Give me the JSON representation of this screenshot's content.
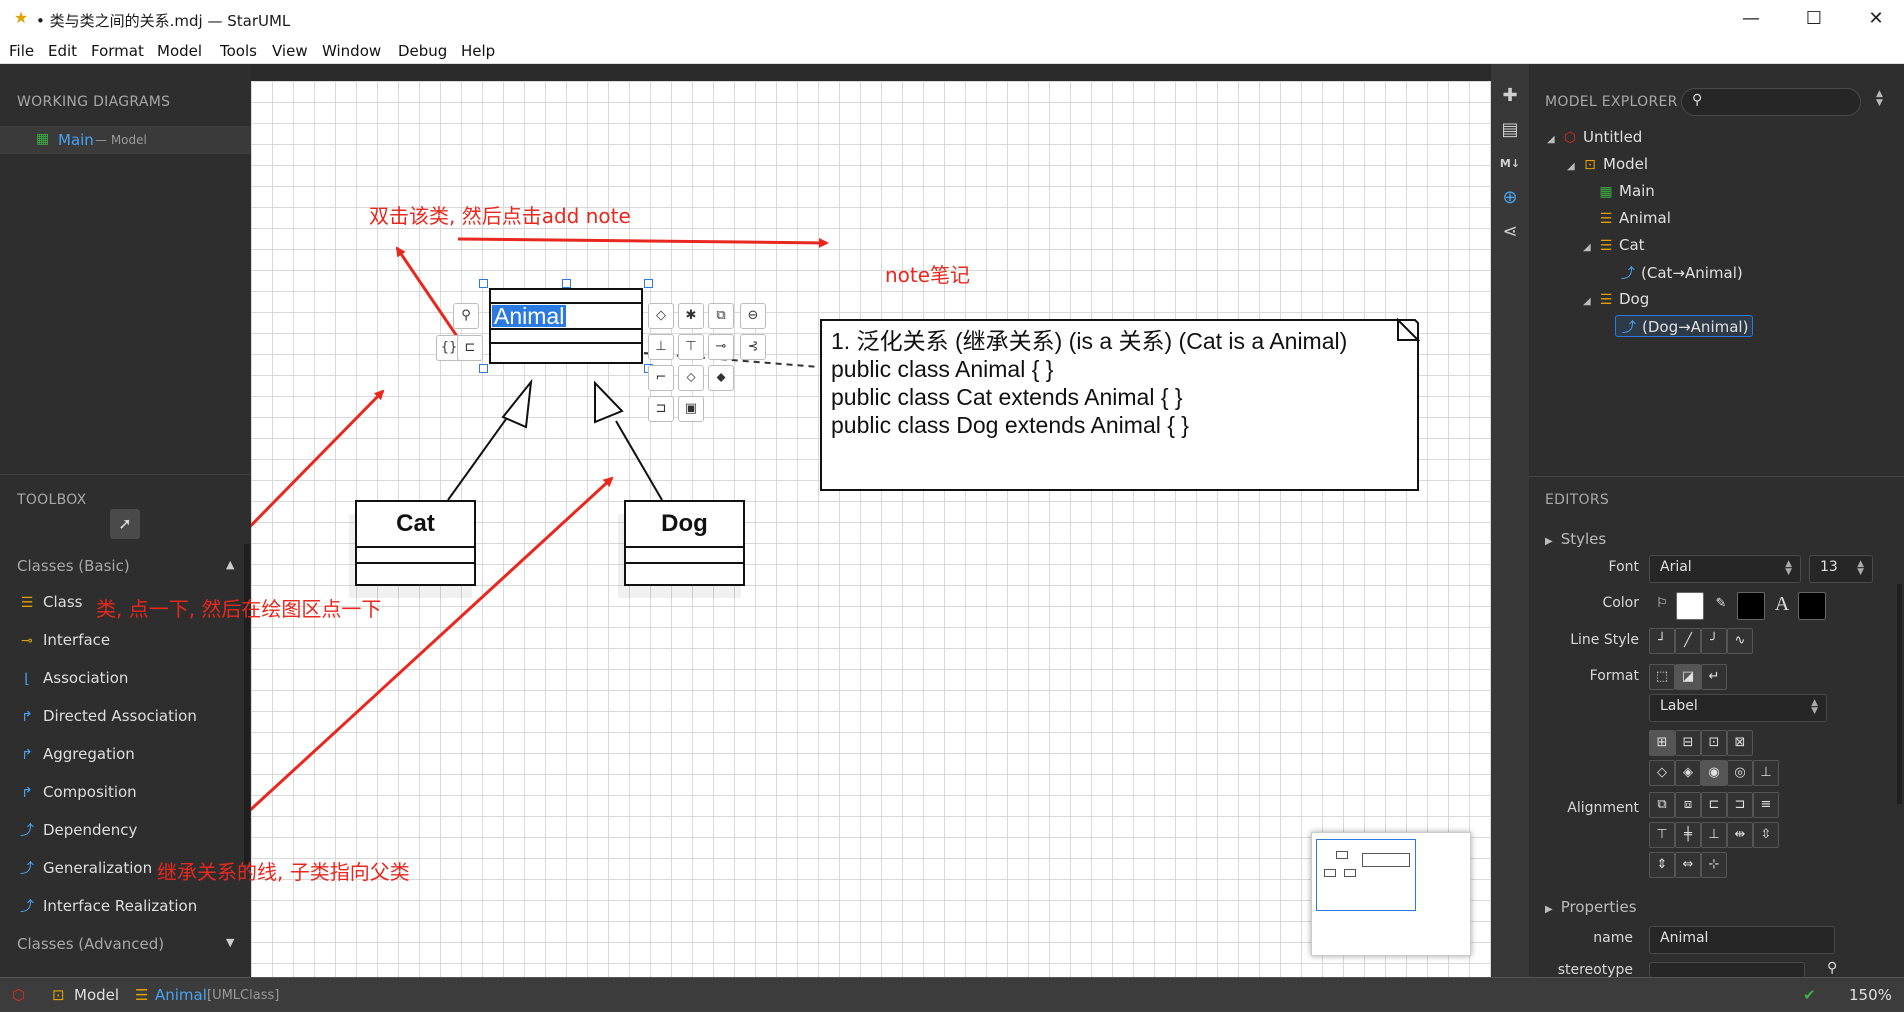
{
  "window": {
    "title": "• 类与类之间的关系.mdj — StarUML",
    "buttons": {
      "minimize": "—",
      "maximize": "☐",
      "close": "✕"
    }
  },
  "menu": [
    "File",
    "Edit",
    "Format",
    "Model",
    "Tools",
    "View",
    "Window",
    "Debug",
    "Help"
  ],
  "working_diagrams": {
    "header": "WORKING DIAGRAMS",
    "item_label": "Main",
    "item_sub": "— Model"
  },
  "toolbox": {
    "header": "TOOLBOX",
    "group_basic": "Classes (Basic)",
    "group_advanced": "Classes (Advanced)",
    "items": [
      {
        "label": "Class",
        "icon": "class-icon"
      },
      {
        "label": "Interface",
        "icon": "interface-icon"
      },
      {
        "label": "Association",
        "icon": "association-icon"
      },
      {
        "label": "Directed Association",
        "icon": "directed-association-icon"
      },
      {
        "label": "Aggregation",
        "icon": "aggregation-icon"
      },
      {
        "label": "Composition",
        "icon": "composition-icon"
      },
      {
        "label": "Dependency",
        "icon": "dependency-icon"
      },
      {
        "label": "Generalization",
        "icon": "generalization-icon"
      },
      {
        "label": "Interface Realization",
        "icon": "interface-realization-icon"
      }
    ]
  },
  "diagram": {
    "classes": {
      "animal": "Animal",
      "cat": "Cat",
      "dog": "Dog"
    },
    "note_lines": [
      "1. 泛化关系 (继承关系) (is a 关系) (Cat is a Animal)",
      "public class Animal { }",
      "public class Cat extends Animal { }",
      "public class Dog extends Animal { }"
    ],
    "annotations": {
      "double_click": "双击该类, 然后点击add note",
      "note": "note笔记",
      "class_tip": "类, 点一下, 然后在绘图区点一下",
      "generalization_tip": "继承关系的线, 子类指向父类"
    }
  },
  "model_explorer": {
    "header": "MODEL EXPLORER",
    "search_placeholder": "",
    "tree": [
      {
        "label": "Untitled",
        "depth": 0,
        "expanded": true,
        "icon": "project-icon"
      },
      {
        "label": "Model",
        "depth": 1,
        "expanded": true,
        "icon": "model-icon"
      },
      {
        "label": "Main",
        "depth": 2,
        "icon": "diagram-icon"
      },
      {
        "label": "Animal",
        "depth": 2,
        "icon": "class-icon"
      },
      {
        "label": "Cat",
        "depth": 2,
        "expanded": true,
        "icon": "class-icon"
      },
      {
        "label": "(Cat→Animal)",
        "depth": 3,
        "icon": "generalization-icon"
      },
      {
        "label": "Dog",
        "depth": 2,
        "expanded": true,
        "icon": "class-icon"
      },
      {
        "label": "(Dog→Animal)",
        "depth": 3,
        "icon": "generalization-icon",
        "selected": true
      }
    ]
  },
  "editors": {
    "header": "EDITORS",
    "styles_label": "Styles",
    "font_label": "Font",
    "font_value": "Arial",
    "font_size": "13",
    "color_label": "Color",
    "line_style_label": "Line Style",
    "format_label": "Format",
    "format_value": "Label",
    "alignment_label": "Alignment",
    "properties_label": "Properties",
    "name_label": "name",
    "name_value": "Animal",
    "stereotype_label": "stereotype"
  },
  "status": {
    "model": "Model",
    "element_name": "Animal",
    "element_type": "[UMLClass]",
    "zoom": "150%"
  },
  "colors": {
    "accent": "#2a7ae2",
    "annotation_red": "#e8281e",
    "ok_green": "#3cb043"
  }
}
